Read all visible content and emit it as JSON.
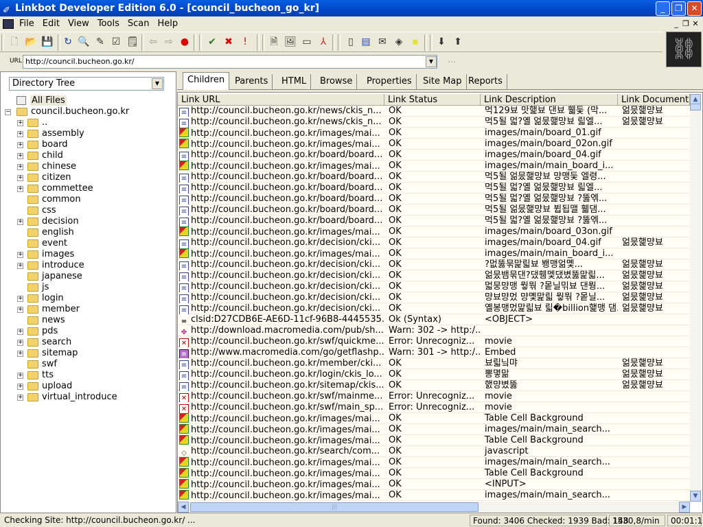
{
  "window": {
    "title": "Linkbot Developer Edition 6.0  - [council_bucheon_go_kr]"
  },
  "menu": [
    "File",
    "Edit",
    "View",
    "Tools",
    "Scan",
    "Help"
  ],
  "toolbar": {
    "icons": [
      "new-icon",
      "open-icon",
      "save-icon",
      "refresh-icon",
      "scan-icon",
      "edit-icon",
      "clipboard-icon",
      "properties-icon",
      "back-icon",
      "forward-icon",
      "stop-icon",
      "check-icon",
      "cross-icon",
      "exclamation-icon",
      "document-icon",
      "image-icon",
      "window-icon",
      "pdf-icon",
      "page-icon",
      "ftp-icon",
      "mail-icon",
      "tag-icon",
      "note-icon",
      "download-icon",
      "upload-icon"
    ]
  },
  "url": {
    "label": "URL",
    "value": "http://council.bucheon.go.kr/",
    "more": "..."
  },
  "tree": {
    "selector": "Directory Tree",
    "all_files": "All Files",
    "root": "council.bucheon.go.kr",
    "items": [
      {
        "n": "..",
        "p": true
      },
      {
        "n": "assembly",
        "p": true
      },
      {
        "n": "board",
        "p": true
      },
      {
        "n": "child",
        "p": true
      },
      {
        "n": "chinese",
        "p": true
      },
      {
        "n": "citizen",
        "p": true
      },
      {
        "n": "commettee",
        "p": true
      },
      {
        "n": "common",
        "p": false
      },
      {
        "n": "css",
        "p": false
      },
      {
        "n": "decision",
        "p": true
      },
      {
        "n": "english",
        "p": false
      },
      {
        "n": "event",
        "p": false
      },
      {
        "n": "images",
        "p": true
      },
      {
        "n": "introduce",
        "p": true
      },
      {
        "n": "japanese",
        "p": false
      },
      {
        "n": "js",
        "p": false
      },
      {
        "n": "login",
        "p": true
      },
      {
        "n": "member",
        "p": true
      },
      {
        "n": "news",
        "p": false
      },
      {
        "n": "pds",
        "p": true
      },
      {
        "n": "search",
        "p": true
      },
      {
        "n": "sitemap",
        "p": true
      },
      {
        "n": "swf",
        "p": false
      },
      {
        "n": "tts",
        "p": true
      },
      {
        "n": "upload",
        "p": true
      },
      {
        "n": "virtual_introduce",
        "p": true
      }
    ]
  },
  "tabs": [
    "Children",
    "Parents",
    "HTML",
    "Browse",
    "Properties",
    "Site Map",
    "Reports"
  ],
  "active_tab": "Children",
  "columns": [
    "Link URL",
    "Link Status",
    "Link Description",
    "Link Document T"
  ],
  "rows": [
    [
      "doc",
      "http://council.bucheon.go.kr/news/ckis_n...",
      "OK",
      "먹129뵤 맛햁뵤 댄뵤 휇둦 (막...",
      "얾뭈햁먕뵤"
    ],
    [
      "doc",
      "http://council.bucheon.go.kr/news/ckis_n...",
      "OK",
      "먹5될 멃?옐 얾뭈햁먕뵤 릷엘...",
      "얾뭈햁먕뵤"
    ],
    [
      "img",
      "http://council.bucheon.go.kr/images/mai...",
      "OK",
      "images/main/board_01.gif",
      ""
    ],
    [
      "img",
      "http://council.bucheon.go.kr/images/mai...",
      "OK",
      "images/main/board_02on.gif",
      ""
    ],
    [
      "doc",
      "http://council.bucheon.go.kr/board/board...",
      "OK",
      "images/main/board_04.gif",
      ""
    ],
    [
      "img",
      "http://council.bucheon.go.kr/images/mai...",
      "OK",
      "images/main/main_board_i...",
      ""
    ],
    [
      "doc",
      "http://council.bucheon.go.kr/board/board...",
      "OK",
      "먹5될 얾뭈햁먕뵤 먕맹둦 엘령...",
      ""
    ],
    [
      "doc",
      "http://council.bucheon.go.kr/board/board...",
      "OK",
      "먹5될 멃?옐 얾뭈햁먕뵤 릷엘...",
      ""
    ],
    [
      "doc",
      "http://council.bucheon.go.kr/board/board...",
      "OK",
      "먹5될 멃?옐 얾뭈햁먕뵤 ?뚫엒...",
      ""
    ],
    [
      "doc",
      "http://council.bucheon.go.kr/board/board...",
      "OK",
      "먹5될 얾뭈햁먕뵤 뷥됩맬 휇댐...",
      ""
    ],
    [
      "doc",
      "http://council.bucheon.go.kr/board/board...",
      "OK",
      "먹5될 멃?옐 얾뭈햁먕뵤 ?뚫엒...",
      ""
    ],
    [
      "img",
      "http://council.bucheon.go.kr/images/mai...",
      "OK",
      "images/main/board_03on.gif",
      ""
    ],
    [
      "doc",
      "http://council.bucheon.go.kr/decision/cki...",
      "OK",
      "images/main/board_04.gif",
      "얾뭈햁먕뵤"
    ],
    [
      "img",
      "http://council.bucheon.go.kr/images/mai...",
      "OK",
      "images/main/main_board_i...",
      ""
    ],
    [
      "doc",
      "http://council.bucheon.go.kr/decision/cki...",
      "OK",
      "?멊뚫묶맕릷뵤 뵁맹얾몣...",
      "얾뭈햁먕뵤"
    ],
    [
      "doc",
      "http://council.bucheon.go.kr/decision/cki...",
      "OK",
      "얾뭈뱀묶댄?댔휑멫댔볐뚫맕릷...",
      "얾뭈햁먕뵤"
    ],
    [
      "doc",
      "http://council.bucheon.go.kr/decision/cki...",
      "OK",
      "멃뭉먕맹 뭫뭒 ?뫁닐믺뵤 댄뭥...",
      "얾뭈햁먕뵤"
    ],
    [
      "doc",
      "http://council.bucheon.go.kr/decision/cki...",
      "OK",
      "먕뵤먕멌 먕몣맕릷 뭫뭒 ?뫁닐...",
      "얾뭈햁먕뵤"
    ],
    [
      "doc",
      "http://council.bucheon.go.kr/decision/cki...",
      "OK",
      "옐봉맹멌맕릷뵤 릷�billion햁맹 댐...",
      "얾뭈햁먕뵤"
    ],
    [
      "obj",
      "clsid:D27CDB6E-AE6D-11cf-96B8-4445535...",
      "Ok (Syntax)",
      "<OBJECT>",
      ""
    ],
    [
      "flash",
      "http://download.macromedia.com/pub/sh...",
      "Warn: 302 -> http:/...",
      "",
      ""
    ],
    [
      "x",
      "http://council.bucheon.go.kr/swf/quickme...",
      "Error: Unrecogniz...",
      "movie",
      ""
    ],
    [
      "emb",
      "http://www.macromedia.com/go/getflashp...",
      "Warn: 301 -> http:/...",
      "Embed",
      ""
    ],
    [
      "doc",
      "http://council.bucheon.go.kr/member/cki...",
      "OK",
      "뵤릷닠먀",
      "얾뭈햁먕뵤"
    ],
    [
      "doc",
      "http://council.bucheon.go.kr/login/ckis_lo...",
      "OK",
      "뽕몋맒",
      "얾뭈햁먕뵤"
    ],
    [
      "doc",
      "http://council.bucheon.go.kr/sitemap/ckis...",
      "OK",
      "햀먕볐뚫",
      "얾뭈햁먕뵤"
    ],
    [
      "x",
      "http://council.bucheon.go.kr/swf/mainme...",
      "Error: Unrecogniz...",
      "movie",
      ""
    ],
    [
      "x",
      "http://council.bucheon.go.kr/swf/main_sp...",
      "Error: Unrecogniz...",
      "movie",
      ""
    ],
    [
      "img",
      "http://council.bucheon.go.kr/images/mai...",
      "OK",
      "Table Cell Background",
      ""
    ],
    [
      "img",
      "http://council.bucheon.go.kr/images/mai...",
      "OK",
      "images/main/main_search...",
      ""
    ],
    [
      "img",
      "http://council.bucheon.go.kr/images/mai...",
      "OK",
      "Table Cell Background",
      ""
    ],
    [
      "js",
      "http://council.bucheon.go.kr/search/com...",
      "OK",
      "javascript",
      ""
    ],
    [
      "img",
      "http://council.bucheon.go.kr/images/mai...",
      "OK",
      "images/main/main_search...",
      ""
    ],
    [
      "img",
      "http://council.bucheon.go.kr/images/mai...",
      "OK",
      "Table Cell Background",
      ""
    ],
    [
      "img",
      "http://council.bucheon.go.kr/images/mai...",
      "OK",
      "<INPUT>",
      ""
    ],
    [
      "img",
      "http://council.bucheon.go.kr/images/mai...",
      "OK",
      "images/main/main_search...",
      ""
    ]
  ],
  "status": {
    "message": "Checking Site: http://council.bucheon.go.kr/ ...",
    "counts": "Found: 3406 Checked: 1939 Bad: 148",
    "rate": "1530,8/min",
    "elapsed": "00:01:16"
  }
}
